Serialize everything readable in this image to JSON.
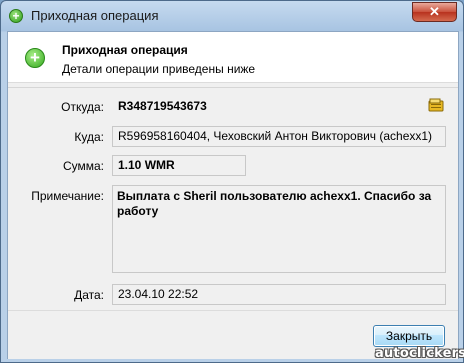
{
  "window": {
    "title": "Приходная операция",
    "icon": "add-icon",
    "close_label": "✕"
  },
  "header": {
    "icon": "plus-circle-icon",
    "title": "Приходная операция",
    "subtitle": "Детали операции приведены ниже"
  },
  "fields": {
    "from": {
      "label": "Откуда:",
      "value": "R348719543673",
      "icon": "wallet-icon"
    },
    "to": {
      "label": "Куда:",
      "value": "R596958160404, Чеховский Антон Викторович (achexx1)"
    },
    "amount": {
      "label": "Сумма:",
      "value": "1.10 WMR"
    },
    "note": {
      "label": "Примечание:",
      "value": "Выплата с Sheril пользователю achexx1. Спасибо за работу"
    },
    "date": {
      "label": "Дата:",
      "value": "23.04.10 22:52"
    }
  },
  "footer": {
    "close_button": "Закрыть"
  },
  "watermark": "autoclickers"
}
